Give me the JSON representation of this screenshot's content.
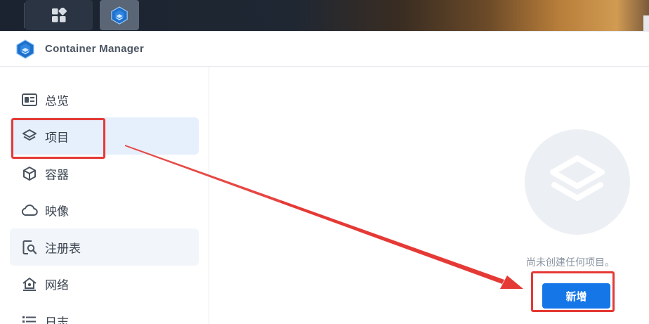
{
  "taskbar": {
    "main_menu_icon": "grid-icon",
    "app_icon": "container-manager-icon"
  },
  "window": {
    "title": "Container Manager",
    "icon": "container-manager-icon"
  },
  "sidebar": {
    "items": [
      {
        "label": "总览",
        "icon": "overview-icon"
      },
      {
        "label": "项目",
        "icon": "layers-icon",
        "active": true
      },
      {
        "label": "容器",
        "icon": "cube-icon"
      },
      {
        "label": "映像",
        "icon": "cloud-icon"
      },
      {
        "label": "注册表",
        "icon": "registry-search-icon"
      },
      {
        "label": "网络",
        "icon": "network-home-icon"
      },
      {
        "label": "日志",
        "icon": "list-icon"
      }
    ]
  },
  "main": {
    "empty_icon": "layers-icon",
    "empty_message": "尚未创建任何项目。",
    "create_button": "新增"
  },
  "colors": {
    "accent": "#1576e8",
    "active_bg": "#e6f0fc",
    "annotation": "#e53935"
  }
}
